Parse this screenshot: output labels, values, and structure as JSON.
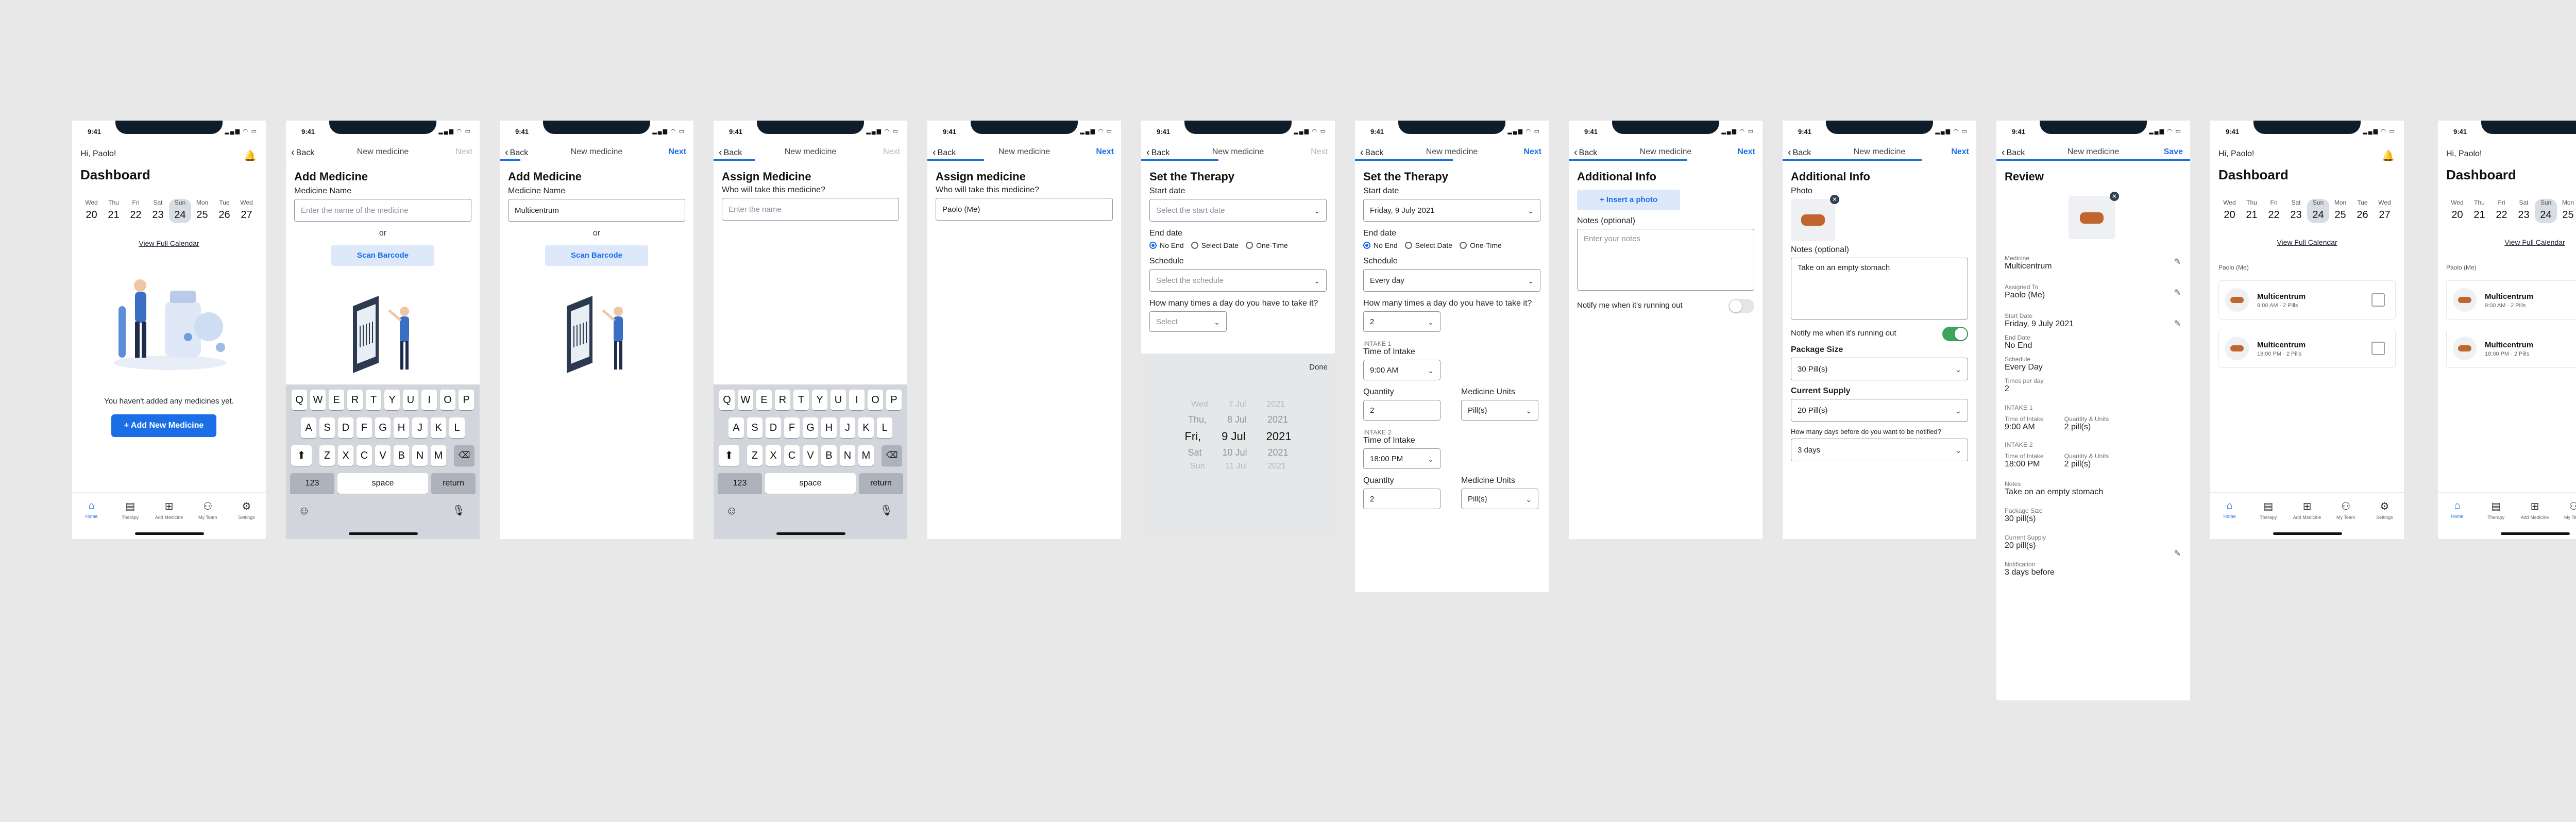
{
  "status_time": "9:41",
  "status_icons": "▂▄▆ ◠ ▭",
  "nav": {
    "back": "Back",
    "title": "New medicine",
    "next": "Next",
    "save": "Save"
  },
  "dashboard": {
    "greeting": "Hi, Paolo!",
    "title": "Dashboard",
    "days": [
      {
        "name": "Wed",
        "num": "20"
      },
      {
        "name": "Thu",
        "num": "21"
      },
      {
        "name": "Fri",
        "num": "22"
      },
      {
        "name": "Sat",
        "num": "23"
      },
      {
        "name": "Sun",
        "num": "24"
      },
      {
        "name": "Mon",
        "num": "25"
      },
      {
        "name": "Tue",
        "num": "26"
      },
      {
        "name": "Wed",
        "num": "27"
      }
    ],
    "view_calendar": "View Full Calendar",
    "empty_text": "You haven't added any medicines yet.",
    "add_button": "+ Add New Medicine",
    "owner": "Paolo (Me)"
  },
  "tabs": [
    {
      "label": "Home",
      "icon": "⌂"
    },
    {
      "label": "Therapy",
      "icon": "▤"
    },
    {
      "label": "Add Medicine",
      "icon": "⊞"
    },
    {
      "label": "My Team",
      "icon": "⚇"
    },
    {
      "label": "Settings",
      "icon": "⚙"
    }
  ],
  "add_medicine": {
    "title": "Add Medicine",
    "name_label": "Medicine Name",
    "name_placeholder": "Enter the name of the medicine",
    "name_value": "Multicentrum",
    "or": "or",
    "scan": "Scan Barcode"
  },
  "keyboard": {
    "row1": [
      "Q",
      "W",
      "E",
      "R",
      "T",
      "Y",
      "U",
      "I",
      "O",
      "P"
    ],
    "row2": [
      "A",
      "S",
      "D",
      "F",
      "G",
      "H",
      "J",
      "K",
      "L"
    ],
    "row3": [
      "Z",
      "X",
      "C",
      "V",
      "B",
      "N",
      "M"
    ],
    "shift": "⬆",
    "del": "⌫",
    "num": "123",
    "space": "space",
    "return": "return",
    "emoji": "☺",
    "mic": "🎙"
  },
  "assign": {
    "title1": "Assign Medicine",
    "title2": "Assign medicine",
    "question": "Who will take this medicine?",
    "placeholder": "Enter the name",
    "value": "Paolo (Me)"
  },
  "therapy": {
    "title": "Set the Therapy",
    "start_label": "Start date",
    "start_placeholder": "Select the start date",
    "start_value": "Friday, 9 July 2021",
    "end_label": "End date",
    "end_options": [
      "No End",
      "Select Date",
      "One-Time"
    ],
    "schedule_label": "Schedule",
    "schedule_placeholder": "Select the schedule",
    "schedule_value": "Every day",
    "times_label": "How many times a day do you have to take it?",
    "times_placeholder": "Select",
    "times_value": "2",
    "done": "Done",
    "picker_rows": [
      [
        "Wed",
        "7 Jul",
        "2021"
      ],
      [
        "Thu,",
        "8 Jul",
        "2021"
      ],
      [
        "Fri,",
        "9 Jul",
        "2021"
      ],
      [
        "Sat",
        "10 Jul",
        "2021"
      ],
      [
        "Sun",
        "11 Jul",
        "2021"
      ]
    ],
    "intake1": "INTAKE 1",
    "intake2": "INTAKE 2",
    "time_label": "Time of Intake",
    "time1": "9:00 AM",
    "time2": "18:00 PM",
    "quantity_label": "Quantity",
    "quantity": "2",
    "units_label": "Medicine Units",
    "units": "Pill(s)"
  },
  "additional": {
    "title": "Additional Info",
    "insert_photo": "+ Insert a photo",
    "notes_label": "Notes (optional)",
    "notes_placeholder": "Enter your notes",
    "notify_label": "Notify me when it's running out",
    "photo_label": "Photo",
    "notes_value": "Take on an empty stomach",
    "package_label": "Package Size",
    "package_value": "30 Pill(s)",
    "supply_label": "Current Supply",
    "supply_value": "20 Pill(s)",
    "days_label": "How many days before do you want to be notified?",
    "days_value": "3 days"
  },
  "review": {
    "title": "Review",
    "medicine_label": "Medicine",
    "medicine": "Multicentrum",
    "assigned_label": "Assigned To",
    "assigned": "Paolo (Me)",
    "start_label": "Start Date",
    "start": "Friday, 9 July 2021",
    "end_label": "End Date",
    "end": "No End",
    "schedule_label": "Schedule",
    "schedule": "Every Day",
    "times_label": "Times per day",
    "times": "2",
    "intake1": "INTAKE 1",
    "intake2": "INTAKE 2",
    "time_label": "Time of Intake",
    "qty_label": "Quantity & Units",
    "time1": "9:00 AM",
    "time2": "18:00 PM",
    "qty": "2 pill(s)",
    "notes_label": "Notes",
    "notes": "Take on an empty stomach",
    "package_label": "Package Size",
    "package": "30 pill(s)",
    "supply_label": "Current Supply",
    "supply": "20 pill(s)",
    "notification_label": "Notification",
    "notification": "3 days before"
  },
  "med_list": [
    {
      "name": "Multicentrum",
      "sub": "9:00 AM · 2 Pills"
    },
    {
      "name": "Multicentrum",
      "sub": "18:00 PM · 2 Pills"
    }
  ],
  "colors": {
    "accent": "#1a6fe6",
    "success": "#3ba55c",
    "canvas": "#e8e8e8"
  }
}
